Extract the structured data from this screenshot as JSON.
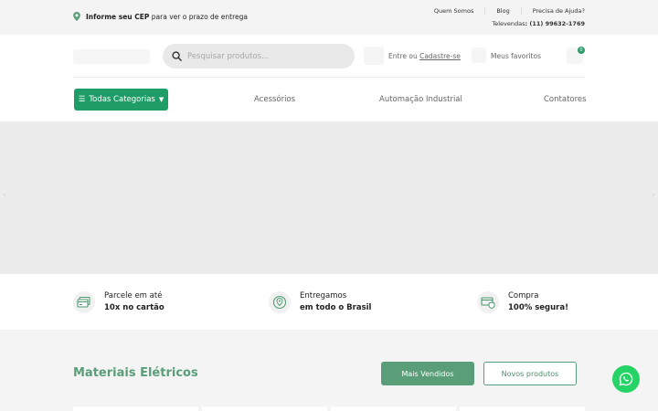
{
  "topbar": {
    "cep_bold": "Informe seu CEP",
    "cep_rest": " para ver o prazo de entrega",
    "links": [
      "Quem Somos",
      "Blog",
      "Precisa de Ajuda?"
    ],
    "televendas_label": "Televendas",
    "televendas_number": ": (11) 99632-1769"
  },
  "header": {
    "search_placeholder": "Pesquisar produtos...",
    "account_prefix": "Entre ou ",
    "account_link": "Cadastre-se",
    "favorites_label": "Meus favoritos",
    "cart_count": "0"
  },
  "nav": {
    "categories_label": "Todas Categorias",
    "items": [
      "Acessórios",
      "Automação Industrial",
      "Contatores"
    ]
  },
  "banner": {
    "prev": "‹",
    "next": "›"
  },
  "features": [
    {
      "line1": "Parcele em até",
      "line2": "10x no cartão"
    },
    {
      "line1": "Entregamos",
      "line2": "em todo o Brasil"
    },
    {
      "line1": "Compra",
      "line2": "100% segura!"
    }
  ],
  "section": {
    "title": "Materiais Elétricos",
    "tab_best": "Mais Vendidos",
    "tab_new": "Novos produtos"
  },
  "colors": {
    "accent": "#1f9d67",
    "section_green": "#5a9e79",
    "whatsapp": "#25d366"
  }
}
